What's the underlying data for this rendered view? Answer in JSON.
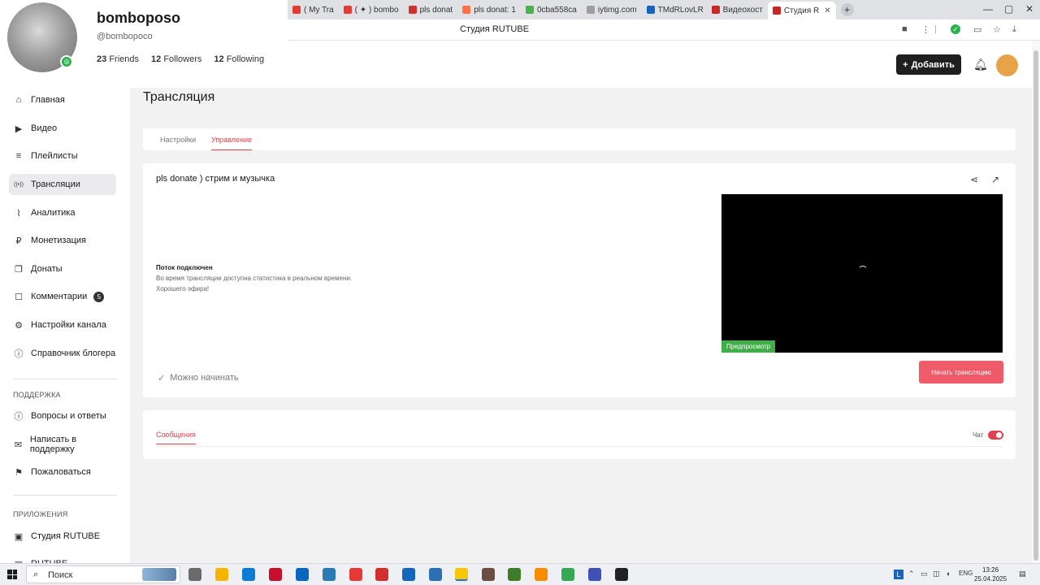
{
  "browser": {
    "tabs": [
      {
        "label": "( My Tra",
        "color": "#e53935"
      },
      {
        "label": "( ✦ ) bombo",
        "color": "#e53935"
      },
      {
        "label": "pls donat",
        "color": "#d32f2f"
      },
      {
        "label": "pls donat: 1",
        "color": "#ff7043"
      },
      {
        "label": "0cba558ca",
        "color": "#4caf50"
      },
      {
        "label": "iytimg.com",
        "color": "#9e9e9e"
      },
      {
        "label": "TMdRLovLR",
        "color": "#1565c0"
      },
      {
        "label": "Видеохост",
        "color": "#c62828"
      },
      {
        "label": "Студия R",
        "color": "#c62828",
        "active": true
      }
    ],
    "page_title": "Студия RUTUBE"
  },
  "profile": {
    "name": "bomboposo",
    "handle": "@bombopoco",
    "friends_count": "23",
    "friends_label": "Friends",
    "followers_count": "12",
    "followers_label": "Followers",
    "following_count": "12",
    "following_label": "Following"
  },
  "header": {
    "add_label": "Добавить"
  },
  "sidebar": {
    "items": [
      {
        "label": "Главная",
        "icon": "home-icon"
      },
      {
        "label": "Видео",
        "icon": "video-icon"
      },
      {
        "label": "Плейлисты",
        "icon": "playlist-icon"
      },
      {
        "label": "Трансляции",
        "icon": "broadcast-icon",
        "active": true
      },
      {
        "label": "Аналитика",
        "icon": "analytics-icon"
      },
      {
        "label": "Монетизация",
        "icon": "monetization-icon"
      },
      {
        "label": "Донаты",
        "icon": "donate-icon"
      },
      {
        "label": "Комментарии",
        "icon": "comment-icon",
        "badge": "5"
      },
      {
        "label": "Настройки канала",
        "icon": "settings-icon"
      },
      {
        "label": "Справочник блогера",
        "icon": "info-icon"
      }
    ],
    "support_title": "ПОДДЕРЖКА",
    "support_items": [
      {
        "label": "Вопросы и ответы"
      },
      {
        "label": "Написать в поддержку"
      },
      {
        "label": "Пожаловаться"
      }
    ],
    "apps_title": "ПРИЛОЖЕНИЯ",
    "apps_items": [
      {
        "label": "Студия RUTUBE"
      },
      {
        "label": "RUTUBE"
      }
    ]
  },
  "main": {
    "page_title": "Трансляция",
    "tabs": [
      {
        "label": "Настройки"
      },
      {
        "label": "Управление",
        "active": true
      }
    ],
    "stream_title": "pls donate ) стрим и музычка",
    "status_title": "Поток подключен",
    "status_line1": "Во время трансляции доступна статистика в реальном времени.",
    "status_line2": "Хорошего эфира!",
    "ready_label": "Можно начинать",
    "preview_label": "Предпросмотр",
    "start_button": "Начать трансляцию",
    "messages_tab": "Сообщения",
    "chat_label": "Чат",
    "chat_enabled": true
  },
  "taskbar": {
    "search_placeholder": "Поиск",
    "lang": "ENG",
    "time": "13:26",
    "date": "25.04.2025"
  }
}
